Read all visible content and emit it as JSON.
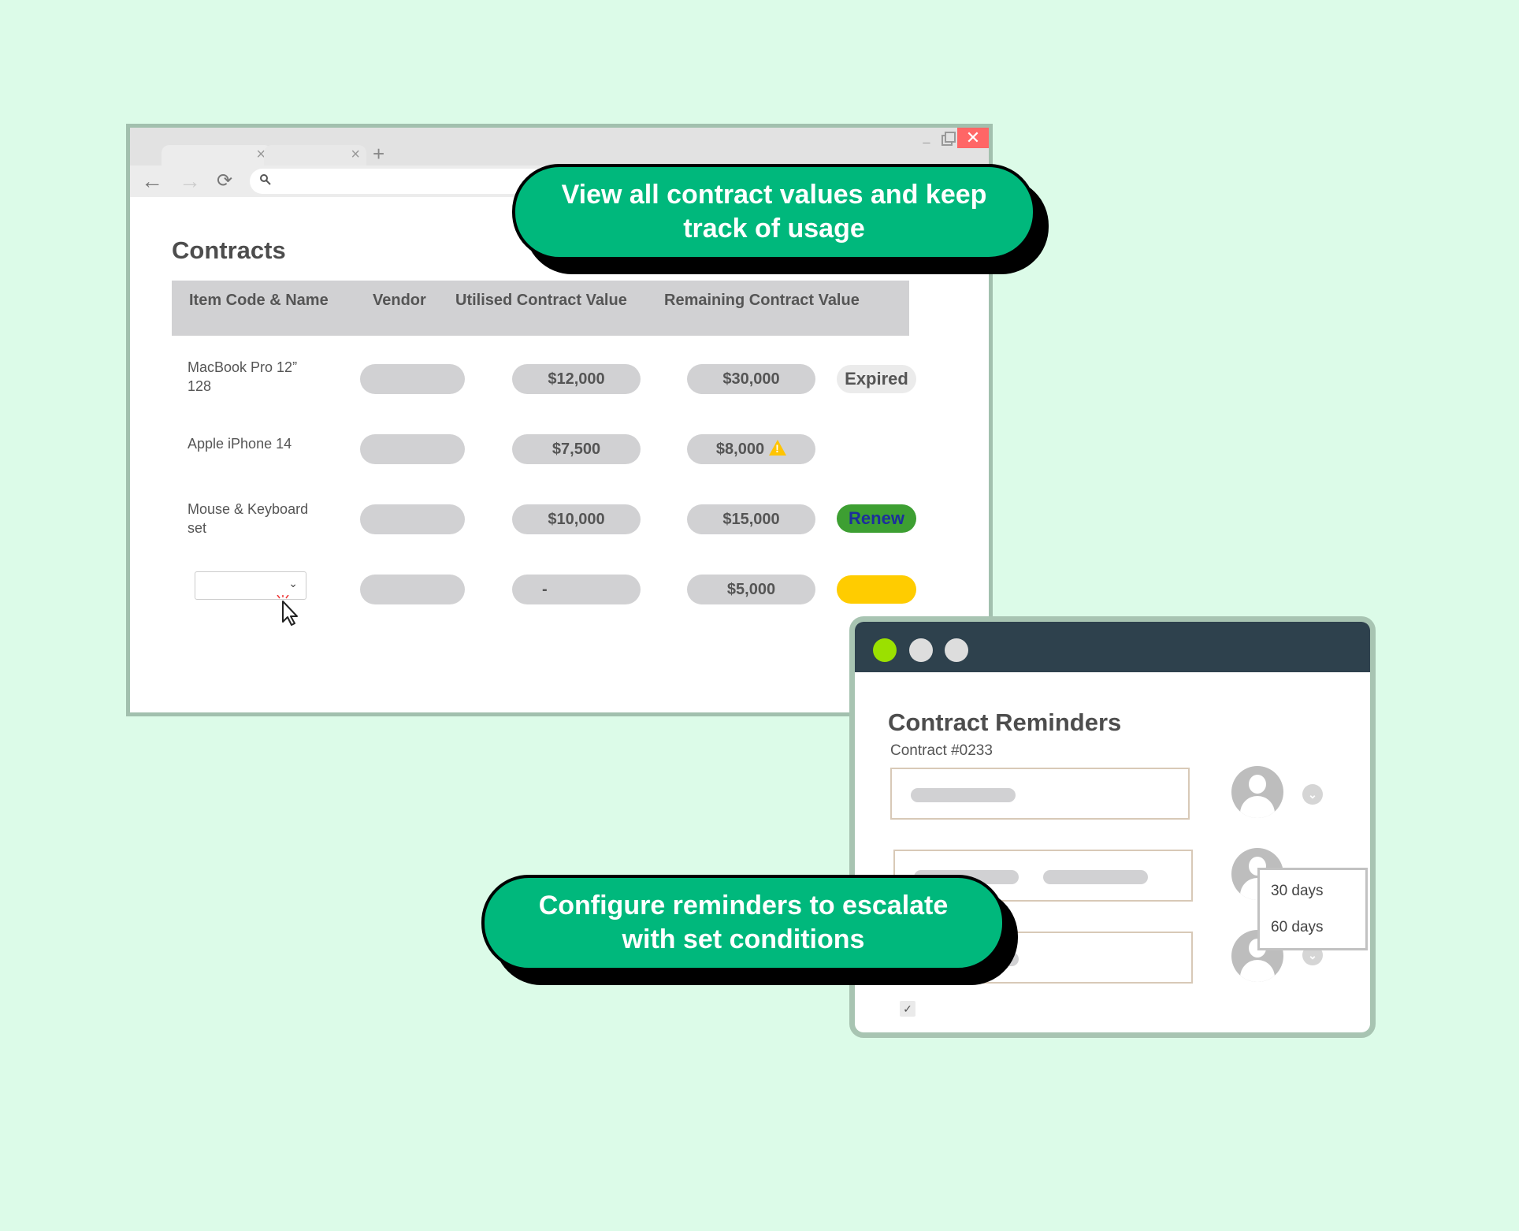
{
  "browser": {
    "tabs": [
      {
        "label": "",
        "close_icon": "×"
      },
      {
        "label": "",
        "close_icon": "×"
      }
    ],
    "new_tab_icon": "+",
    "window_controls": {
      "minimize": "_",
      "close": "✕"
    },
    "nav": {
      "back": "←",
      "forward": "→",
      "reload": "⟳"
    },
    "address_bar": {
      "value": "",
      "search_icon": "🔍"
    }
  },
  "contracts": {
    "title": "Contracts",
    "columns": [
      "Item Code & Name",
      "Vendor",
      "Utilised Contract Value",
      "Remaining Contract Value"
    ],
    "rows": [
      {
        "item": "MacBook Pro 12” 128",
        "vendor": "",
        "utilised": "$12,000",
        "remaining": "$30,000",
        "status": "Expired",
        "warning": false
      },
      {
        "item": "Apple iPhone 14",
        "vendor": "",
        "utilised": "$7,500",
        "remaining": "$8,000",
        "status": "",
        "warning": true
      },
      {
        "item": "Mouse & Keyboard set",
        "vendor": "",
        "utilised": "$10,000",
        "remaining": "$15,000",
        "status": "Renew",
        "warning": false
      },
      {
        "item": "",
        "vendor": "",
        "utilised": "-",
        "remaining": "$5,000",
        "status": "",
        "warning": false
      }
    ],
    "colors": {
      "renew_bg": "#3d9f32",
      "renew_text": "#1c2f9c",
      "pending": "#ffcc00",
      "warning": "#ffc400"
    }
  },
  "callouts": {
    "top": "View all contract values and keep track of usage",
    "bottom": "Configure reminders to escalate with set conditions",
    "color": "#00b87c"
  },
  "reminders": {
    "title": "Contract Reminders",
    "subtitle": "Contract #0233",
    "dropdown_options": [
      "30 days",
      "60 days"
    ],
    "checkbox_checked": true,
    "titlebar_dot_active": "#9be000"
  }
}
